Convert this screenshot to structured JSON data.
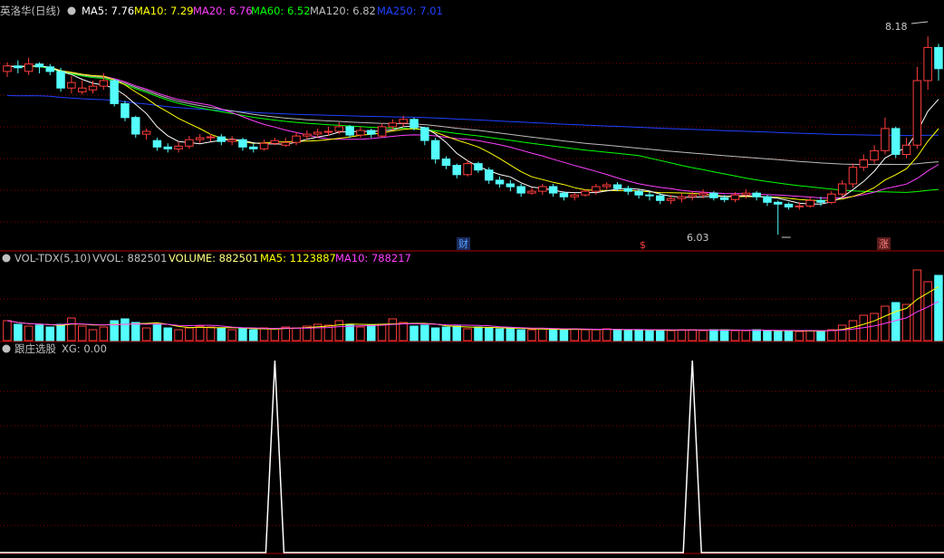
{
  "colors": {
    "up": "#ff3c3c",
    "down": "#54fcfc",
    "ma5": "#ffffff",
    "ma10": "#ffff00",
    "ma20": "#ff40ff",
    "ma60": "#00ff00",
    "ma120": "#bdbdbd",
    "ma250": "#2040ff",
    "grid": "#8b0000",
    "label_white": "#c8c8c8",
    "text_gray": "#c0c0c0"
  },
  "price_panel": {
    "title": "英洛华(日线)",
    "legend": [
      {
        "label": "MA5: 7.76",
        "color": "#ffffff"
      },
      {
        "label": "MA10: 7.29",
        "color": "#ffff00"
      },
      {
        "label": "MA20: 6.76",
        "color": "#ff40ff"
      },
      {
        "label": "MA60: 6.52",
        "color": "#00ff00"
      },
      {
        "label": "MA120: 6.82",
        "color": "#bdbdbd"
      },
      {
        "label": "MA250: 7.01",
        "color": "#2040ff"
      }
    ],
    "high_label": "8.18",
    "low_label": "6.03",
    "markers": [
      {
        "text": "财",
        "color": "#54a0ff"
      },
      {
        "text": "$",
        "color": "#ff3c3c"
      },
      {
        "text": "涨",
        "color": "#ff8080"
      }
    ]
  },
  "volume_panel": {
    "legend": [
      {
        "label": "VOL-TDX(5,10)",
        "color": "#c0c0c0"
      },
      {
        "label": "VVOL: 882501",
        "color": "#c0c0c0"
      },
      {
        "label": "VOLUME: 882501",
        "color": "#ffff80"
      },
      {
        "label": "MA5: 1123887",
        "color": "#ffff00"
      },
      {
        "label": "MA10: 788217",
        "color": "#ff40ff"
      }
    ]
  },
  "indicator_panel": {
    "legend": [
      {
        "label": "跟庄选股",
        "color": "#c0c0c0"
      },
      {
        "label": "XG: 0.00",
        "color": "#c0c0c0"
      }
    ]
  },
  "chart_data": {
    "type": "candlestick",
    "series_indices": [
      "0",
      "1",
      "2",
      "3",
      "4",
      "5",
      "6",
      "7",
      "8",
      "9",
      "10",
      "11",
      "12",
      "13",
      "14",
      "15",
      "16",
      "17",
      "18",
      "19",
      "20",
      "21",
      "22",
      "23",
      "24",
      "25",
      "26",
      "27",
      "28",
      "29",
      "30",
      "31",
      "32",
      "33",
      "34",
      "35",
      "36",
      "37",
      "38",
      "39",
      "40",
      "41",
      "42",
      "43",
      "44",
      "45",
      "46",
      "47",
      "48",
      "49",
      "50",
      "51",
      "52",
      "53",
      "54",
      "55",
      "56",
      "57",
      "58",
      "59",
      "60",
      "61",
      "62",
      "63",
      "64",
      "65",
      "66",
      "67",
      "68",
      "69",
      "70",
      "71",
      "72",
      "73",
      "74",
      "75",
      "76",
      "77",
      "78",
      "79",
      "80",
      "81",
      "82",
      "83",
      "84",
      "85",
      "86",
      "87"
    ],
    "close": [
      7.86,
      7.84,
      7.88,
      7.85,
      7.8,
      7.62,
      7.68,
      7.62,
      7.64,
      7.7,
      7.45,
      7.3,
      7.12,
      7.15,
      6.98,
      6.96,
      6.99,
      7.06,
      7.08,
      7.09,
      7.04,
      7.06,
      6.98,
      6.96,
      7.02,
      7.05,
      7.03,
      7.1,
      7.12,
      7.14,
      7.15,
      7.2,
      7.11,
      7.16,
      7.12,
      7.2,
      7.24,
      7.28,
      7.19,
      7.05,
      6.85,
      6.78,
      6.68,
      6.8,
      6.73,
      6.62,
      6.58,
      6.55,
      6.48,
      6.5,
      6.55,
      6.48,
      6.44,
      6.46,
      6.5,
      6.55,
      6.57,
      6.53,
      6.5,
      6.46,
      6.45,
      6.4,
      6.42,
      6.44,
      6.46,
      6.48,
      6.43,
      6.41,
      6.46,
      6.48,
      6.44,
      6.38,
      6.36,
      6.33,
      6.34,
      6.4,
      6.38,
      6.47,
      6.58,
      6.76,
      6.84,
      6.94,
      7.18,
      6.9,
      7.0,
      7.7,
      8.06,
      7.83
    ],
    "open": [
      7.8,
      7.86,
      7.8,
      7.88,
      7.85,
      7.8,
      7.62,
      7.58,
      7.6,
      7.64,
      7.7,
      7.45,
      7.3,
      7.12,
      7.05,
      6.98,
      6.96,
      6.99,
      7.06,
      7.08,
      7.09,
      7.04,
      7.06,
      6.98,
      6.96,
      7.02,
      7.0,
      7.03,
      7.1,
      7.12,
      7.14,
      7.15,
      7.2,
      7.11,
      7.16,
      7.1,
      7.2,
      7.24,
      7.28,
      7.19,
      7.05,
      6.85,
      6.78,
      6.68,
      6.8,
      6.73,
      6.62,
      6.58,
      6.55,
      6.48,
      6.5,
      6.55,
      6.48,
      6.44,
      6.46,
      6.5,
      6.55,
      6.57,
      6.53,
      6.5,
      6.46,
      6.45,
      6.4,
      6.42,
      6.44,
      6.46,
      6.48,
      6.43,
      6.41,
      6.46,
      6.48,
      6.44,
      6.38,
      6.36,
      6.33,
      6.34,
      6.4,
      6.38,
      6.47,
      6.58,
      6.76,
      6.84,
      6.94,
      7.18,
      6.9,
      7.0,
      7.7,
      8.06
    ],
    "high": [
      7.9,
      7.92,
      7.95,
      7.9,
      7.88,
      7.84,
      7.75,
      7.7,
      7.7,
      7.78,
      7.72,
      7.48,
      7.32,
      7.18,
      7.08,
      7.02,
      7.04,
      7.1,
      7.12,
      7.12,
      7.12,
      7.1,
      7.08,
      7.02,
      7.06,
      7.08,
      7.08,
      7.14,
      7.16,
      7.18,
      7.2,
      7.25,
      7.22,
      7.2,
      7.18,
      7.24,
      7.28,
      7.32,
      7.3,
      7.2,
      7.08,
      6.88,
      6.8,
      6.84,
      6.82,
      6.76,
      6.66,
      6.62,
      6.58,
      6.54,
      6.58,
      6.58,
      6.5,
      6.48,
      6.52,
      6.58,
      6.6,
      6.6,
      6.56,
      6.52,
      6.5,
      6.48,
      6.46,
      6.48,
      6.5,
      6.52,
      6.5,
      6.46,
      6.49,
      6.52,
      6.5,
      6.46,
      6.4,
      6.38,
      6.38,
      6.44,
      6.44,
      6.5,
      6.62,
      6.8,
      6.9,
      7.0,
      7.3,
      7.2,
      7.08,
      7.85,
      8.18,
      8.1
    ],
    "low": [
      7.74,
      7.78,
      7.76,
      7.78,
      7.76,
      7.58,
      7.56,
      7.55,
      7.56,
      7.6,
      7.42,
      7.26,
      7.08,
      7.06,
      6.94,
      6.92,
      6.92,
      6.96,
      7.02,
      7.04,
      7.0,
      7.0,
      6.94,
      6.92,
      6.94,
      7.0,
      6.98,
      7.0,
      7.06,
      7.08,
      7.1,
      7.12,
      7.08,
      7.08,
      7.08,
      7.08,
      7.16,
      7.2,
      7.16,
      7.0,
      6.8,
      6.74,
      6.64,
      6.66,
      6.7,
      6.58,
      6.54,
      6.5,
      6.44,
      6.46,
      6.46,
      6.44,
      6.4,
      6.4,
      6.44,
      6.46,
      6.52,
      6.5,
      6.46,
      6.42,
      6.4,
      6.36,
      6.36,
      6.38,
      6.4,
      6.42,
      6.4,
      6.38,
      6.38,
      6.42,
      6.4,
      6.34,
      6.03,
      6.3,
      6.3,
      6.32,
      6.34,
      6.36,
      6.44,
      6.54,
      6.72,
      6.8,
      6.9,
      6.86,
      6.86,
      6.96,
      7.6,
      7.7
    ],
    "volume": [
      22,
      18,
      16,
      17,
      15,
      18,
      25,
      16,
      12,
      15,
      22,
      24,
      20,
      14,
      18,
      14,
      12,
      14,
      16,
      15,
      14,
      12,
      13,
      12,
      14,
      13,
      15,
      14,
      16,
      18,
      17,
      22,
      18,
      15,
      17,
      18,
      24,
      20,
      16,
      17,
      14,
      15,
      16,
      13,
      15,
      14,
      13,
      14,
      12,
      12,
      13,
      12,
      12,
      13,
      12,
      12,
      13,
      12,
      11,
      12,
      11,
      12,
      11,
      12,
      12,
      11,
      12,
      12,
      11,
      11,
      12,
      11,
      10,
      11,
      10,
      11,
      11,
      12,
      17,
      22,
      28,
      30,
      38,
      42,
      40,
      78,
      65,
      72
    ],
    "xg_signal": [
      0,
      0,
      0,
      0,
      0,
      0,
      0,
      0,
      0,
      0,
      0,
      0,
      0,
      0,
      0,
      0,
      0,
      0,
      0,
      0,
      0,
      0,
      0,
      0,
      0,
      1,
      0,
      0,
      0,
      0,
      0,
      0,
      0,
      0,
      0,
      0,
      0,
      0,
      0,
      0,
      0,
      0,
      0,
      0,
      0,
      0,
      0,
      0,
      0,
      0,
      0,
      0,
      0,
      0,
      0,
      0,
      0,
      0,
      0,
      0,
      0,
      0,
      0,
      0,
      1,
      0,
      0,
      0,
      0,
      0,
      0,
      0,
      0,
      0,
      0,
      0,
      0,
      0,
      0,
      0,
      0,
      0,
      0,
      0,
      0,
      0,
      0,
      0
    ],
    "ma_long_levels": {
      "MA60": 6.52,
      "MA120": 6.82,
      "MA250": 7.01
    },
    "price_ylim": [
      6.0,
      8.3
    ],
    "grid": true
  }
}
